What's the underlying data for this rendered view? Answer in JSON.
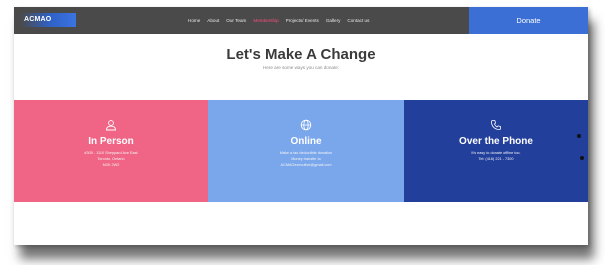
{
  "nav": {
    "logo": "ACMAO",
    "items": [
      {
        "label": "Home",
        "active": false
      },
      {
        "label": "About",
        "active": false
      },
      {
        "label": "Our Team",
        "active": false
      },
      {
        "label": "Membership",
        "active": true
      },
      {
        "label": "Projects/ Events",
        "active": false
      },
      {
        "label": "Gallery",
        "active": false
      },
      {
        "label": "Contact us",
        "active": false
      }
    ],
    "donate_label": "Donate"
  },
  "hero": {
    "title": "Let's Make A Change",
    "subtitle": "Here are some ways you can donate:"
  },
  "panels": [
    {
      "icon": "person-icon",
      "title": "In Person",
      "lines": [
        "#305 - 1110 Sheppard Ave East",
        "Toronto, Ontario",
        "M2K 2W2"
      ],
      "color": "#f06585"
    },
    {
      "icon": "globe-icon",
      "title": "Online",
      "lines": [
        "Make a tax deductible donation",
        "Money transfer to",
        "ACMAOexecutive@gmail.com"
      ],
      "color": "#7aa6ec"
    },
    {
      "icon": "phone-icon",
      "title": "Over the Phone",
      "lines": [
        "It's easy to donate offline too.",
        "Tel: (416) 221 - 7300"
      ],
      "color": "#223f9c"
    }
  ],
  "colors": {
    "nav_bg": "#4a4a4a",
    "donate_bg": "#3b6fd6",
    "active_link": "#ff4d7a"
  }
}
